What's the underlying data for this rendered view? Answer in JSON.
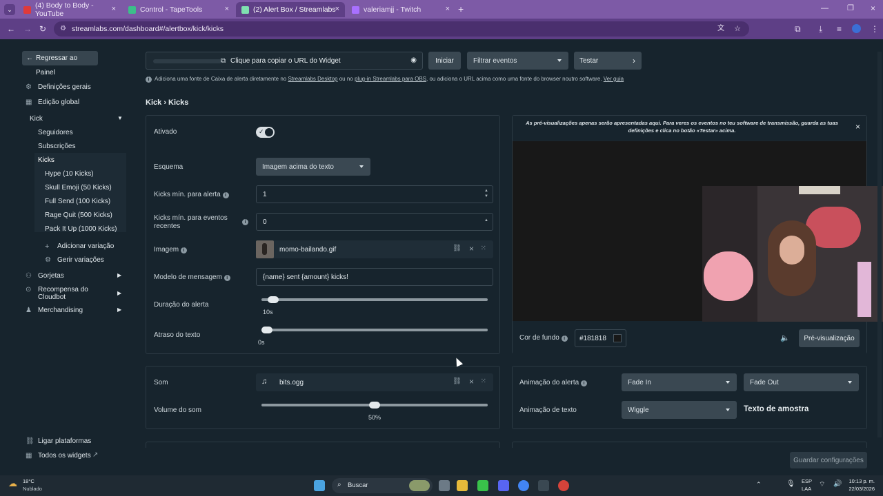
{
  "browser": {
    "tabs": [
      {
        "label": "(4) Body to Body - YouTube",
        "color": "#e03a3a"
      },
      {
        "label": "Control - TapeTools",
        "color": "#3cbf8a"
      },
      {
        "label": "(2) Alert Box / Streamlabs",
        "color": "#7fe0b0"
      },
      {
        "label": "valeriamjj - Twitch",
        "color": "#a970ff"
      }
    ],
    "url": "streamlabs.com/dashboard#/alertbox/kick/kicks"
  },
  "sidebar": {
    "back": "Regressar ao Painel",
    "general": "Definições gerais",
    "global_edit": "Edição global",
    "kick": "Kick",
    "followers": "Seguidores",
    "subs": "Subscrições",
    "kicks": "Kicks",
    "variations": [
      "Hype (10 Kicks)",
      "Skull Emoji (50 Kicks)",
      "Full Send (100 Kicks)",
      "Rage Quit (500 Kicks)",
      "Pack It Up (1000 Kicks)"
    ],
    "add_variation": "Adicionar variação",
    "manage_variations": "Gerir variações",
    "tips": "Gorjetas",
    "cloudbot": "Recompensa do Cloudbot",
    "merch": "Merchandising",
    "link_platforms": "Ligar plataformas",
    "all_widgets": "Todos os widgets"
  },
  "toolbar": {
    "copy_url": "Clique para copiar o URL do Widget",
    "start": "Iniciar",
    "filter": "Filtrar eventos",
    "test": "Testar",
    "notice_a": "Adiciona uma fonte de Caixa de alerta diretamente no ",
    "notice_link1": "Streamlabs Desktop",
    "notice_b": " ou no ",
    "notice_link2": "plug-in Streamlabs para OBS",
    "notice_c": ", ou adiciona o URL acima como uma fonte do browser noutro software. ",
    "notice_link3": "Ver guia"
  },
  "breadcrumb": {
    "parent": "Kick",
    "sep": "›",
    "current": "Kicks"
  },
  "form": {
    "enabled_label": "Ativado",
    "enabled": true,
    "layout_label": "Esquema",
    "layout_value": "Imagem acima do texto",
    "min_kicks_label": "Kicks mín. para alerta",
    "min_kicks_value": "1",
    "min_recent_label": "Kicks mín. para eventos recentes",
    "min_recent_value": "0",
    "image_label": "Imagem",
    "image_value": "momo-bailando.gif",
    "message_label": "Modelo de mensagem",
    "message_value": "{name} sent {amount} kicks!",
    "duration_label": "Duração do alerta",
    "duration_value": "10s",
    "duration_fraction": 0.03,
    "text_delay_label": "Atraso do texto",
    "text_delay_value": "0s",
    "text_delay_fraction": 0.0
  },
  "preview": {
    "notice": "As pré-visualizações apenas serão apresentadas aqui. Para veres os eventos no teu software de transmissão, guarda as tuas definições e clica no botão «Testar» acima.",
    "bg_label": "Cor de fundo",
    "bg_value": "#181818",
    "preview_btn": "Pré-visualização"
  },
  "sound": {
    "label": "Som",
    "file": "bits.ogg",
    "volume_label": "Volume do som",
    "volume_value": "50%",
    "volume_fraction": 0.5
  },
  "animation": {
    "alert_label": "Animação do alerta",
    "in": "Fade In",
    "out": "Fade Out",
    "text_label": "Animação de texto",
    "text_anim": "Wiggle",
    "sample": "Texto de amostra"
  },
  "save": "Guardar configurações",
  "taskbar": {
    "temp": "18°C",
    "weather": "Nublado",
    "search": "Buscar",
    "lang1": "ESP",
    "lang2": "LAA",
    "time": "10:13 p. m.",
    "date": "22/03/2026"
  }
}
